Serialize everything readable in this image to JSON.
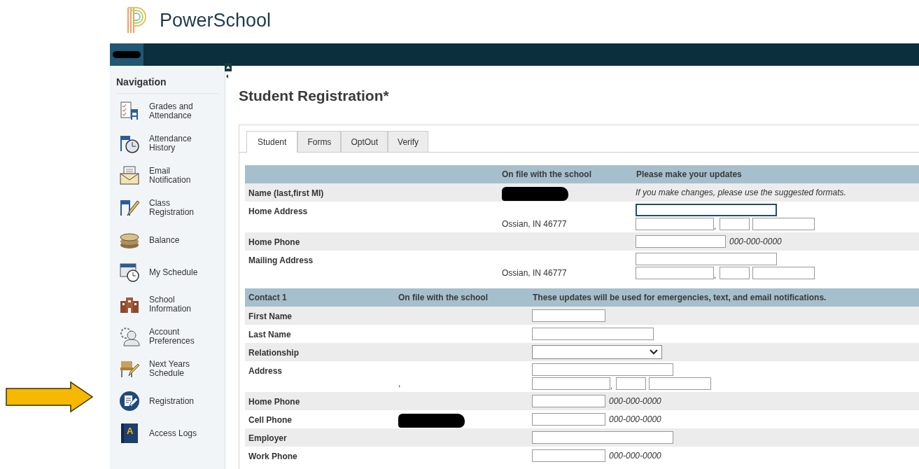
{
  "logo": {
    "text": "PowerSchool"
  },
  "top_bar": {
    "user_redacted": true
  },
  "navigation": {
    "title": "Navigation",
    "items": [
      {
        "label": "Grades and\nAttendance"
      },
      {
        "label": "Attendance\nHistory"
      },
      {
        "label": "Email\nNotification"
      },
      {
        "label": "Class\nRegistration"
      },
      {
        "label": "Balance"
      },
      {
        "label": "My Schedule"
      },
      {
        "label": "School\nInformation"
      },
      {
        "label": "Account\nPreferences"
      },
      {
        "label": "Next Years\nSchedule"
      },
      {
        "label": "Registration"
      },
      {
        "label": "Access Logs",
        "icon_letter": "A"
      }
    ]
  },
  "annotation_arrow": true,
  "page_title": "Student Registration*",
  "tabs": [
    {
      "label": "Student",
      "selected": true
    },
    {
      "label": "Forms",
      "selected": false
    },
    {
      "label": "OptOut",
      "selected": false
    },
    {
      "label": "Verify",
      "selected": false
    }
  ],
  "student_section": {
    "column_2": "On file with the school",
    "column_3": "Please make your updates",
    "rows": [
      {
        "label": "Name (last,first MI)",
        "on_file_redacted": true,
        "note": "If you make changes, please use the suggested formats."
      },
      {
        "label": "Home Address",
        "on_file": "Ossian, IN 46777",
        "field": {
          "kind": "address",
          "separator": ",",
          "focused": true
        }
      },
      {
        "label": "Home Phone",
        "field": {
          "kind": "phone",
          "format_hint": "000-000-0000",
          "focused": false
        }
      },
      {
        "label": "Mailing Address",
        "on_file": "Ossian, IN 46777",
        "field": {
          "kind": "address",
          "separator": ",",
          "focused": false
        }
      }
    ]
  },
  "contact_section": {
    "title": "Contact 1",
    "column_2": "On file with the school",
    "column_3": "These updates will be used for emergencies, text, and email notifications.",
    "rows": [
      {
        "label": "First Name",
        "field": {
          "kind": "short",
          "focused": false
        }
      },
      {
        "label": "Last Name",
        "field": {
          "kind": "wide",
          "focused": false
        }
      },
      {
        "label": "Relationship",
        "field": {
          "kind": "select",
          "focused": false
        }
      },
      {
        "label": "Address",
        "on_file": ",",
        "field": {
          "kind": "address",
          "separator": ",",
          "focused": false
        }
      },
      {
        "label": "Home Phone",
        "field": {
          "kind": "phone",
          "format_hint": "000-000-0000",
          "focused": false
        }
      },
      {
        "label": "Cell Phone",
        "on_file_redacted": true,
        "field": {
          "kind": "phone",
          "format_hint": "000-000-0000",
          "focused": false
        }
      },
      {
        "label": "Employer",
        "field": {
          "kind": "long",
          "focused": false
        }
      },
      {
        "label": "Work Phone",
        "field": {
          "kind": "phone",
          "format_hint": "000-000-0000",
          "focused": false
        }
      }
    ]
  }
}
